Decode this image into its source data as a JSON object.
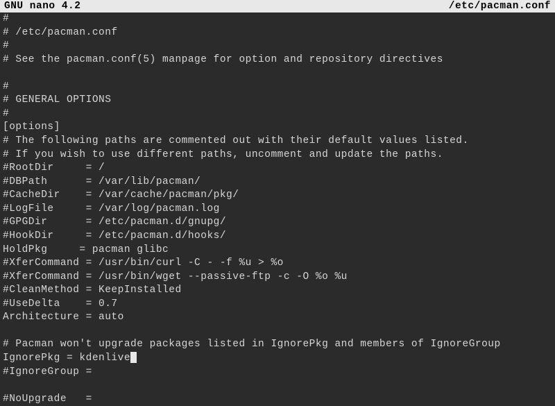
{
  "header": {
    "left": "  GNU nano 4.2",
    "right": "/etc/pacman.conf  "
  },
  "lines": [
    "#",
    "# /etc/pacman.conf",
    "#",
    "# See the pacman.conf(5) manpage for option and repository directives",
    "",
    "#",
    "# GENERAL OPTIONS",
    "#",
    "[options]",
    "# The following paths are commented out with their default values listed.",
    "# If you wish to use different paths, uncomment and update the paths.",
    "#RootDir     = /",
    "#DBPath      = /var/lib/pacman/",
    "#CacheDir    = /var/cache/pacman/pkg/",
    "#LogFile     = /var/log/pacman.log",
    "#GPGDir      = /etc/pacman.d/gnupg/",
    "#HookDir     = /etc/pacman.d/hooks/",
    "HoldPkg     = pacman glibc",
    "#XferCommand = /usr/bin/curl -C - -f %u > %o",
    "#XferCommand = /usr/bin/wget --passive-ftp -c -O %o %u",
    "#CleanMethod = KeepInstalled",
    "#UseDelta    = 0.7",
    "Architecture = auto",
    "",
    "# Pacman won't upgrade packages listed in IgnorePkg and members of IgnoreGroup",
    "IgnorePkg = kdenlive",
    "#IgnoreGroup =",
    "",
    "#NoUpgrade   ="
  ],
  "cursorLine": 25
}
